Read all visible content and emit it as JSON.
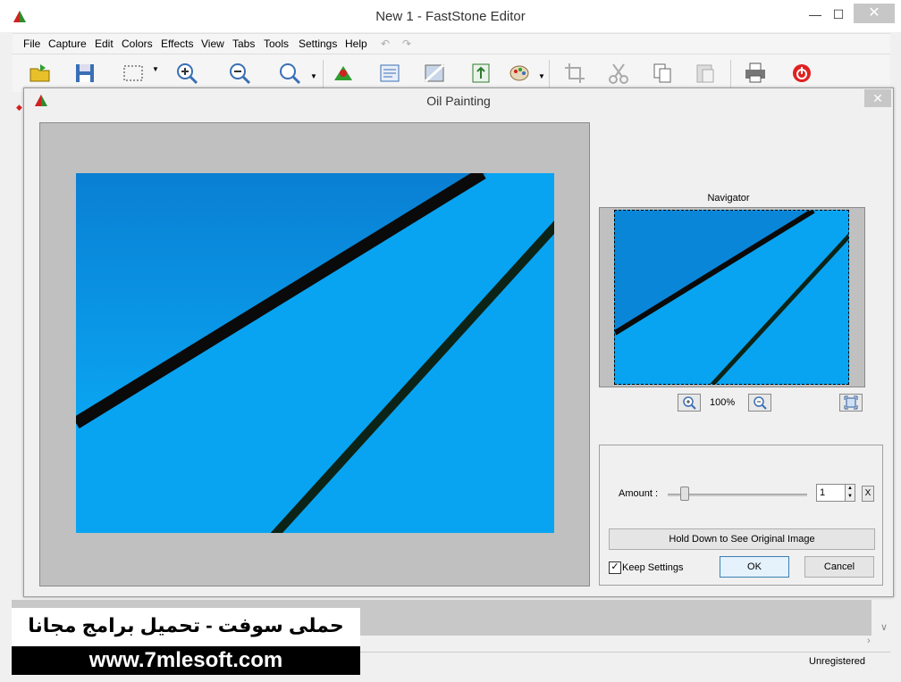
{
  "app": {
    "title": "New 1 - FastStone Editor",
    "minimize": "—",
    "maximize": "☐",
    "close": "✕"
  },
  "menubar": [
    "File",
    "Capture",
    "Edit",
    "Colors",
    "Effects",
    "View",
    "Tabs",
    "Tools",
    "Settings",
    "Help"
  ],
  "dialog": {
    "title": "Oil Painting",
    "close": "✕",
    "navigator_label": "Navigator",
    "zoom_level": "100%",
    "amount_label": "Amount :",
    "amount_value": "1",
    "reset_label": "X",
    "hold_button": "Hold Down to See Original Image",
    "keep_settings_label": "Keep Settings",
    "keep_settings_checked": "✓",
    "ok_button": "OK",
    "cancel_button": "Cancel"
  },
  "status": {
    "registration": "Unregistered"
  },
  "watermark": {
    "arabic": "حملى سوفت - تحميل برامج مجانا",
    "url": "www.7mlesoft.com"
  },
  "colors": {
    "preview_blue": "#06a2f0",
    "stripe_black": "#0a0a0a"
  }
}
